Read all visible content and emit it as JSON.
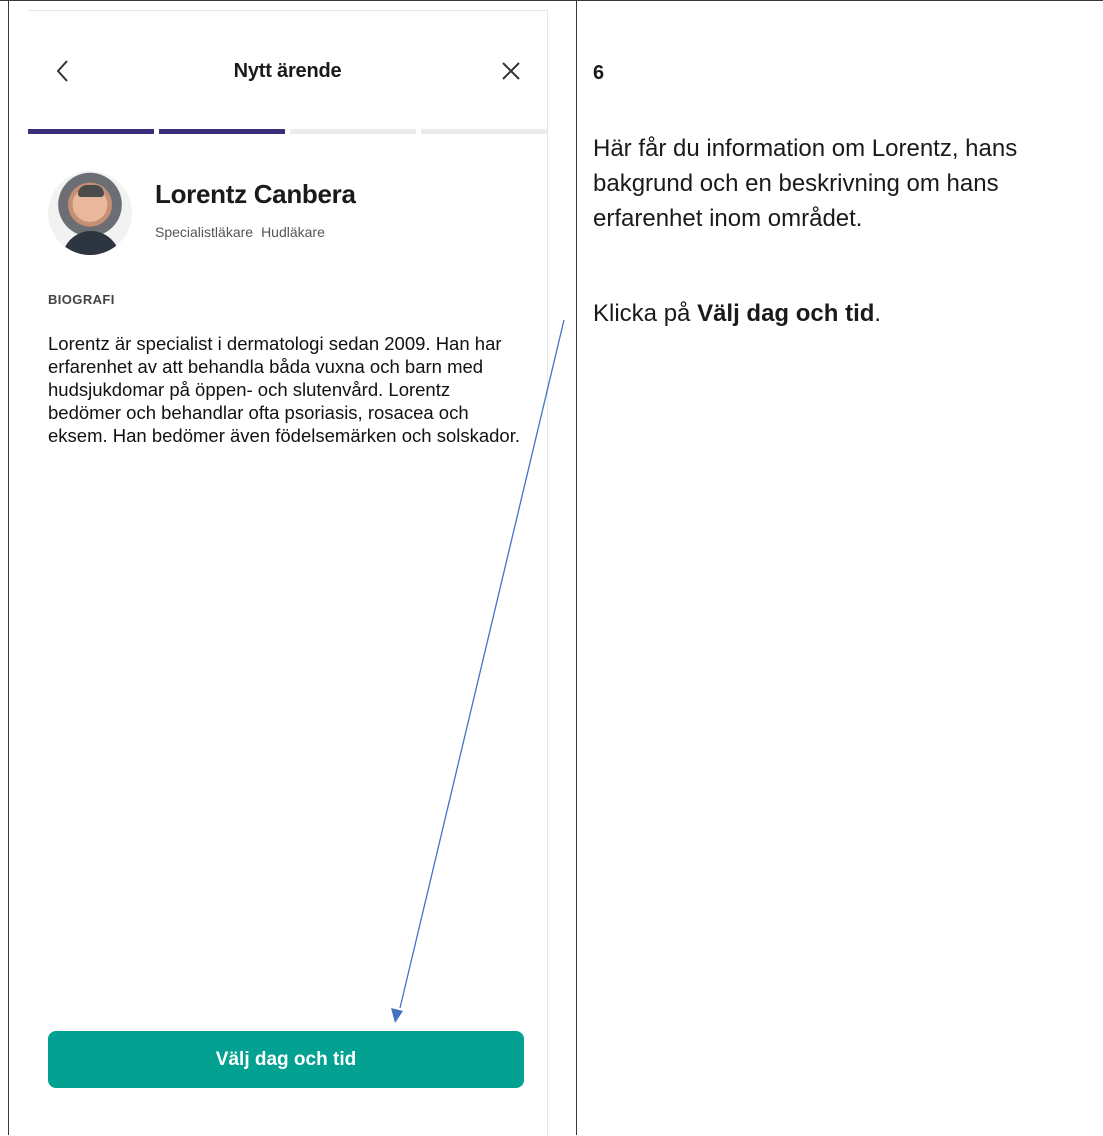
{
  "header": {
    "title": "Nytt ärende"
  },
  "progress": {
    "total_steps": 4,
    "completed_steps": 2
  },
  "doctor": {
    "name": "Lorentz Canbera",
    "tags": [
      "Specialistläkare",
      "Hudläkare"
    ]
  },
  "biography": {
    "heading": "BIOGRAFI",
    "text": "Lorentz är specialist i dermatologi sedan 2009. Han har erfarenhet av att behandla båda vuxna och barn med hudsjukdomar på öppen- och slutenvård. Lorentz bedömer och behandlar ofta psoriasis, rosacea och eksem. Han bedömer även födelsemärken och solskador."
  },
  "cta": {
    "label": "Välj dag och tid"
  },
  "instructions": {
    "step_number": "6",
    "description": "Här får du information om Lorentz, hans bakgrund och en beskrivning om hans erfarenhet inom området.",
    "action_prefix": "Klicka på ",
    "action_bold": "Välj dag och tid",
    "action_suffix": "."
  },
  "colors": {
    "accent": "#3a2f7a",
    "button": "#02a192",
    "arrow": "#4472c4"
  }
}
